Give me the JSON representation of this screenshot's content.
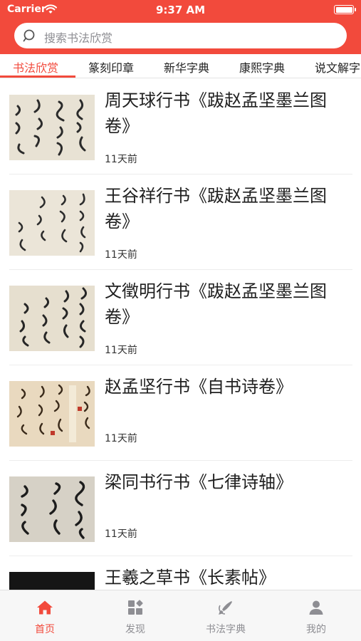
{
  "status_bar": {
    "carrier": "Carrier",
    "time": "9:37 AM"
  },
  "search": {
    "placeholder": "搜索书法欣赏"
  },
  "tabs": [
    {
      "label": "书法欣赏",
      "active": true
    },
    {
      "label": "篆刻印章",
      "active": false
    },
    {
      "label": "新华字典",
      "active": false
    },
    {
      "label": "康熙字典",
      "active": false
    },
    {
      "label": "说文解字",
      "active": false
    }
  ],
  "articles": [
    {
      "title": "周天球行书《跋赵孟坚墨兰图卷》",
      "time": "11天前",
      "thumb": "calligraphy-light"
    },
    {
      "title": "王谷祥行书《跋赵孟坚墨兰图卷》",
      "time": "11天前",
      "thumb": "calligraphy-light"
    },
    {
      "title": "文徵明行书《跋赵孟坚墨兰图卷》",
      "time": "11天前",
      "thumb": "calligraphy-light"
    },
    {
      "title": "赵孟坚行书《自书诗卷》",
      "time": "11天前",
      "thumb": "calligraphy-warm"
    },
    {
      "title": "梁同书行书《七律诗轴》",
      "time": "11天前",
      "thumb": "calligraphy-gray"
    },
    {
      "title": "王羲之草书《长素帖》",
      "time": "",
      "thumb": "calligraphy-dark"
    }
  ],
  "tabbar": [
    {
      "label": "首页",
      "icon": "home-icon",
      "active": true
    },
    {
      "label": "发现",
      "icon": "discover-icon",
      "active": false
    },
    {
      "label": "书法字典",
      "icon": "brush-icon",
      "active": false
    },
    {
      "label": "我的",
      "icon": "profile-icon",
      "active": false
    }
  ],
  "colors": {
    "accent": "#f24a3c",
    "inactive": "#8e8e93"
  }
}
